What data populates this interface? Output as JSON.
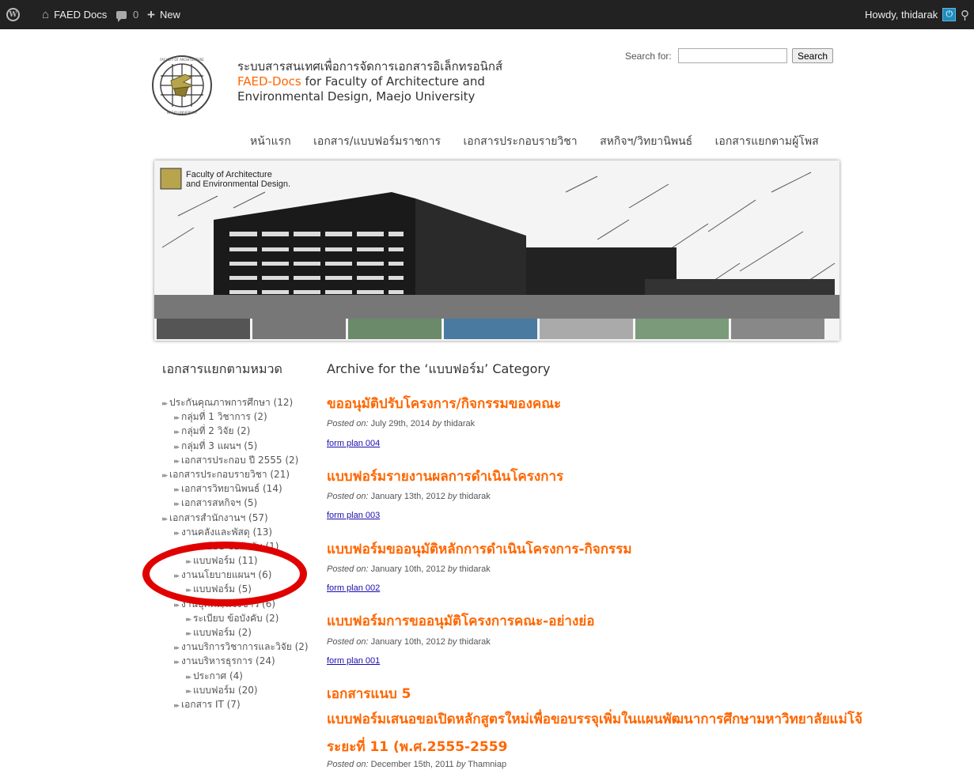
{
  "adminbar": {
    "site_name": "FAED Docs",
    "comments_count": "0",
    "new_label": "New",
    "howdy": "Howdy, thidarak"
  },
  "header": {
    "title_thai": "ระบบสารสนเทศเพื่อการจัดการเอกสารอิเล็กทรอนิกส์",
    "title_en_accent": "FAED-Docs",
    "title_en_1": " for Faculty of Architecture and",
    "title_en_2": "Environmental Design, Maejo University",
    "search_label": "Search for:",
    "search_value": "",
    "search_button": "Search"
  },
  "nav": [
    "หน้าแรก",
    "เอกสาร/แบบฟอร์มราชการ",
    "เอกสารประกอบรายวิชา",
    "สหกิจฯ/วิทยานิพนธ์",
    "เอกสารแยกตามผู้โพส"
  ],
  "banner": {
    "caption_1": "Faculty of Architecture",
    "caption_2": "and Environmental Design."
  },
  "sidebar": {
    "title": "เอกสารแยกตามหมวด",
    "categories": [
      {
        "label": "ประกันคุณภาพการศึกษา (12)",
        "level": 1
      },
      {
        "label": "กลุ่มที่ 1 วิชาการ (2)",
        "level": 2
      },
      {
        "label": "กลุ่มที่ 2 วิจัย (2)",
        "level": 2
      },
      {
        "label": "กลุ่มที่ 3 แผนฯ (5)",
        "level": 2
      },
      {
        "label": "เอกสารประกอบ ปี 2555 (2)",
        "level": 2
      },
      {
        "label": "เอกสารประกอบรายวิชา (21)",
        "level": 1
      },
      {
        "label": "เอกสารวิทยานิพนธ์ (14)",
        "level": 2
      },
      {
        "label": "เอกสารสหกิจฯ (5)",
        "level": 2
      },
      {
        "label": "เอกสารสำนักงานฯ (57)",
        "level": 1
      },
      {
        "label": "งานคลังและพัสดุ (13)",
        "level": 2
      },
      {
        "label": "ระเบียบ ข้อบังคับ (1)",
        "level": 3
      },
      {
        "label": "แบบฟอร์ม (11)",
        "level": 3
      },
      {
        "label": "งานนโยบายแผนฯ (6)",
        "level": 2
      },
      {
        "label": "แบบฟอร์ม (5)",
        "level": 3
      },
      {
        "label": "งานบุคคล/แจ้งข่าว (6)",
        "level": 2
      },
      {
        "label": "ระเบียบ ข้อบังคับ (2)",
        "level": 3
      },
      {
        "label": "แบบฟอร์ม (2)",
        "level": 3
      },
      {
        "label": "งานบริการวิชาการและวิจัย (2)",
        "level": 2
      },
      {
        "label": "งานบริหารธุรการ (24)",
        "level": 2
      },
      {
        "label": "ประกาศ (4)",
        "level": 3
      },
      {
        "label": "แบบฟอร์ม (20)",
        "level": 3
      },
      {
        "label": "เอกสาร IT (7)",
        "level": 2
      }
    ]
  },
  "main": {
    "archive_title": "Archive for the ‘แบบฟอร์ม’ Category",
    "posted_on": "Posted on:",
    "by": "by",
    "posts": [
      {
        "title": "ขออนุมัติปรับโครงการ/กิจกรรมของคณะ",
        "date": "July 29th, 2014",
        "author": "thidarak",
        "link": "form plan 004"
      },
      {
        "title": "แบบฟอร์มรายงานผลการดำเนินโครงการ",
        "date": "January 13th, 2012",
        "author": "thidarak",
        "link": "form plan 003"
      },
      {
        "title": "แบบฟอร์มขออนุมัติหลักการดำเนินโครงการ-กิจกรรม",
        "date": "January 10th, 2012",
        "author": "thidarak",
        "link": "form plan 002"
      },
      {
        "title": "แบบฟอร์มการขออนุมัติโครงการคณะ-อย่างย่อ",
        "date": "January 10th, 2012",
        "author": "thidarak",
        "link": "form plan 001"
      },
      {
        "title_lines": [
          "เอกสารแนบ 5",
          "แบบฟอร์มเสนอขอเปิดหลักสูตรใหม่เพื่อขอบรรจุเพิ่มในแผนพัฒนาการศึกษามหาวิทยาลัยแม่โจ้",
          "ระยะที่ 11 (พ.ศ.2555-2559"
        ],
        "date": "December 15th, 2011",
        "author": "Thamniap"
      }
    ]
  }
}
